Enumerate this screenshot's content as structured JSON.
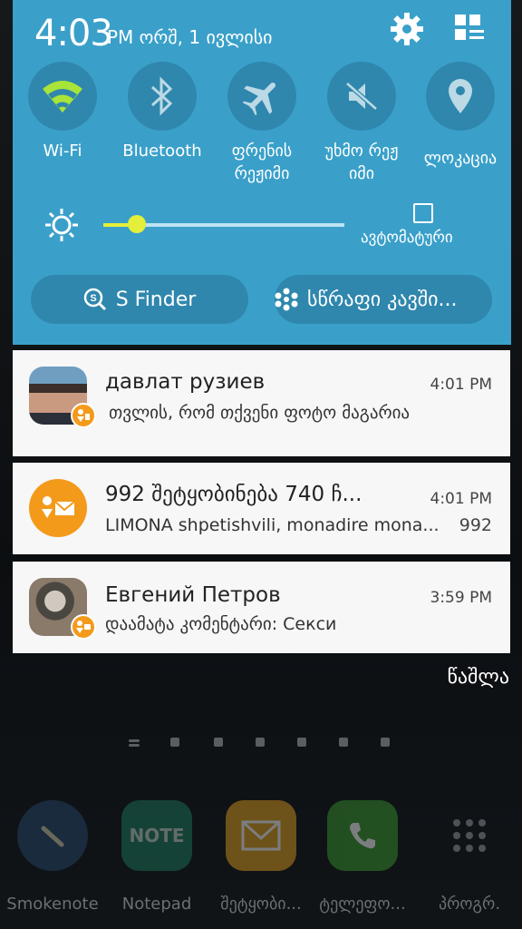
{
  "status": {
    "time": "4:03",
    "date": "PM ორშ, 1 ივლისი"
  },
  "quick_settings": [
    {
      "label": "Wi-Fi",
      "icon": "wifi-icon",
      "active": true
    },
    {
      "label": "Bluetooth",
      "icon": "bluetooth-icon",
      "active": false
    },
    {
      "label_line1": "ფრენის",
      "label_line2": "რეჟიმი",
      "icon": "airplane-icon",
      "active": false
    },
    {
      "label_line1": "უხმო რეჟ",
      "label_line2": "იმი",
      "icon": "mute-icon",
      "active": false
    },
    {
      "label": "ლოკაცია",
      "icon": "location-icon",
      "active": false
    }
  ],
  "brightness": {
    "level": 0.14,
    "auto_label": "ავტომატური",
    "auto_checked": false
  },
  "buttons": {
    "s_finder": "S Finder",
    "quick_connect": "სწრაფი კავში..."
  },
  "notifications": [
    {
      "title": "давлат рузиев",
      "time": "4:01 PM",
      "text": "თვლის, რომ თქვენი ფოტო მაგარია"
    },
    {
      "title": "992 შეტყობინება 740 ჩ...",
      "time": "4:01 PM",
      "text": "LIMONA shpetishvili, monadire mona...",
      "count": "992"
    },
    {
      "title": "Евгений Петров",
      "time": "3:59 PM",
      "text": "დაამატა კომენტარი: Секси"
    }
  ],
  "clear_label": "წაშლა",
  "dock": [
    {
      "label": "Smokenote",
      "icon": "pen-icon"
    },
    {
      "label": "Notepad",
      "icon": "note-icon",
      "icon_text": "NOTE"
    },
    {
      "label": "შეტყობი...",
      "icon": "envelope-icon"
    },
    {
      "label": "ტელეფო...",
      "icon": "phone-icon"
    },
    {
      "label": "პროგრ.",
      "icon": "apps-grid-icon"
    }
  ],
  "colors": {
    "panel": "#3aa0c9",
    "circle": "#2f87ad",
    "accent": "#a8e43a",
    "ok_orange": "#f39a1b"
  }
}
